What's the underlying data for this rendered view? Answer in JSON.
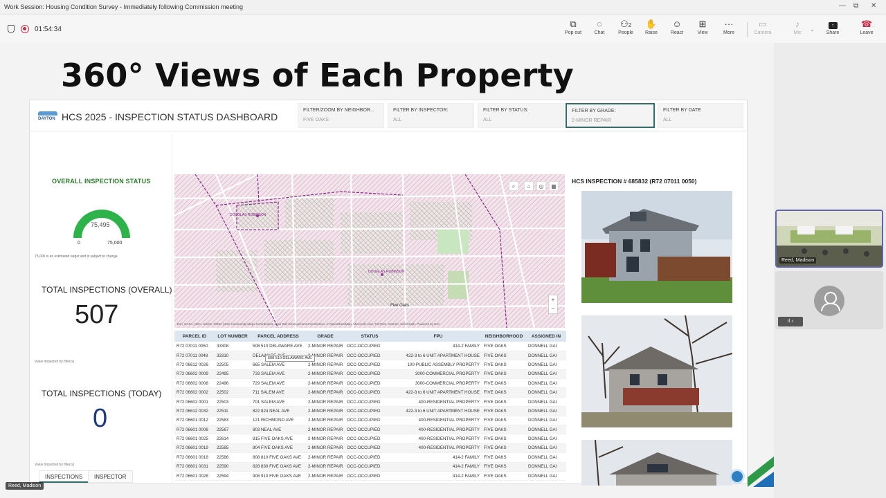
{
  "window": {
    "title": "Work Session: Housing Condition Survey - Immediately following Commission meeting"
  },
  "toolbar": {
    "timer": "01:54:34",
    "buttons": [
      {
        "label": "Pop out",
        "icon": "pop-out-icon"
      },
      {
        "label": "Chat",
        "icon": "chat-icon"
      },
      {
        "label": "People",
        "icon": "people-icon",
        "count": "2"
      },
      {
        "label": "Raise",
        "icon": "raise-hand-icon"
      },
      {
        "label": "React",
        "icon": "react-icon"
      },
      {
        "label": "View",
        "icon": "view-icon"
      },
      {
        "label": "More",
        "icon": "more-icon"
      },
      {
        "label": "Camera",
        "icon": "camera-icon",
        "disabled": true
      },
      {
        "label": "Mic",
        "icon": "mic-icon",
        "disabled": true
      },
      {
        "label": "Share",
        "icon": "share-icon"
      },
      {
        "label": "Leave",
        "icon": "leave-icon"
      }
    ]
  },
  "slide": {
    "title": "360° Views of Each Property"
  },
  "dashboard": {
    "title": "HCS 2025 - INSPECTION STATUS DASHBOARD",
    "logo_text": "DAYTON",
    "filters": [
      {
        "label": "FILTER/ZOOM BY NEIGHBOR...",
        "value": "FIVE OAKS"
      },
      {
        "label": "FILTER BY INSPECTOR:",
        "value": "ALL"
      },
      {
        "label": "FILTER BY STATUS:",
        "value": "ALL"
      },
      {
        "label": "FILTER BY GRADE:",
        "value": "2-MINOR REPAIR",
        "active": true
      },
      {
        "label": "FILTER BY DATE",
        "value": "ALL"
      }
    ],
    "overall": {
      "title": "OVERALL INSPECTION STATUS",
      "gauge_value": "75,495",
      "gauge_min": "0",
      "gauge_max": "75,000",
      "gauge_fraction": 1.0,
      "note": "75,000 is an estimated target and is subject to change"
    },
    "total_overall": {
      "label": "TOTAL INSPECTIONS (OVERALL)",
      "value": "507",
      "note": "Value impacted by filter(s)"
    },
    "total_today": {
      "label": "TOTAL INSPECTIONS (TODAY)",
      "value": "0",
      "note": "Value impacted by filter(s)"
    },
    "tabs": [
      "INSPECTIONS",
      "INSPECTOR"
    ],
    "map": {
      "labels": [
        "DOUGLAS ROBINSON",
        "DOUGLAS ROBINSON",
        "Five Oaks"
      ],
      "attribution": "Esri, NASA, NGA, USGS, FEMA | Esri Community Maps Contributors, Ohio Rail Development Commission, © OpenStreetMap, Microsoft, Esri, TomTom, Garmin, SafeGraph,   Powered by Esri",
      "zoom_in": "+",
      "zoom_out": "−"
    },
    "table": {
      "columns": [
        "PARCEL ID",
        "LOT NUMBER",
        "PARCEL ADDRESS",
        "GRADE",
        "STATUS",
        "FPU",
        "NEIGHBORHOOD",
        "ASSIGNED IN"
      ],
      "rows": [
        [
          "R72 07011 0050",
          "33308",
          "508 510 DELAWARE AVE",
          "2-MINOR REPAIR",
          "OCC-OCCUPIED",
          "414-2 FAMILY",
          "FIVE OAKS",
          "DONNELL GAI"
        ],
        [
          "R72 07011 0048",
          "33310",
          "DELAWARE AVE",
          "2-MINOR REPAIR",
          "OCC-OCCUPIED",
          "422-3 to 6 UNIT APARTMENT HOUSE",
          "FIVE OAKS",
          "DONNELL GAI"
        ],
        [
          "R72 06612 0026",
          "22505",
          "665 SALEM AVE",
          "2-MINOR REPAIR",
          "OCC-OCCUPIED",
          "100-PUBLIC ASSEMBLY PROPERTY",
          "FIVE OAKS",
          "DONNELL GAI"
        ],
        [
          "R72 06602 0009",
          "22495",
          "733 SALEM AVE",
          "2-MINOR REPAIR",
          "OCC-OCCUPIED",
          "3000-COMMERCIAL PROPERTY",
          "FIVE OAKS",
          "DONNELL GAI"
        ],
        [
          "R72 06602 0008",
          "22496",
          "729 SALEM AVE",
          "2-MINOR REPAIR",
          "OCC-OCCUPIED",
          "3000-COMMERCIAL PROPERTY",
          "FIVE OAKS",
          "DONNELL GAI"
        ],
        [
          "R72 06602 0002",
          "22502",
          "711 SALEM AVE",
          "2-MINOR REPAIR",
          "OCC-OCCUPIED",
          "422-3 to 6 UNIT APARTMENT HOUSE",
          "FIVE OAKS",
          "DONNELL GAI"
        ],
        [
          "R72 06602 0001",
          "22503",
          "701 SALEM AVE",
          "2-MINOR REPAIR",
          "OCC-OCCUPIED",
          "400-RESIDENTIAL PROPERTY",
          "FIVE OAKS",
          "DONNELL GAI"
        ],
        [
          "R72 06612 0032",
          "22511",
          "822 824 NEAL AVE",
          "2-MINOR REPAIR",
          "OCC-OCCUPIED",
          "422-3 to 6 UNIT APARTMENT HOUSE",
          "FIVE OAKS",
          "DONNELL GAI"
        ],
        [
          "R72 06601 0012",
          "22583",
          "121 RICHMOND AVE",
          "2-MINOR REPAIR",
          "OCC-OCCUPIED",
          "400-RESIDENTIAL PROPERTY",
          "FIVE OAKS",
          "DONNELL GAI"
        ],
        [
          "R72 06601 0008",
          "22567",
          "803 NEAL AVE",
          "2-MINOR REPAIR",
          "OCC-OCCUPIED",
          "400-RESIDENTIAL PROPERTY",
          "FIVE OAKS",
          "DONNELL GAI"
        ],
        [
          "R72 06601 0025",
          "22614",
          "815 FIVE OAKS AVE",
          "2-MINOR REPAIR",
          "OCC-OCCUPIED",
          "400-RESIDENTIAL PROPERTY",
          "FIVE OAKS",
          "DONNELL GAI"
        ],
        [
          "R72 06601 0019",
          "22585",
          "804 FIVE OAKS AVE",
          "2-MINOR REPAIR",
          "OCC-OCCUPIED",
          "400-RESIDENTIAL PROPERTY",
          "FIVE OAKS",
          "DONNELL GAI"
        ],
        [
          "R72 06601 0018",
          "22586",
          "808 810 FIVE OAKS AVE",
          "2-MINOR REPAIR",
          "OCC-OCCUPIED",
          "414-2 FAMILY",
          "FIVE OAKS",
          "DONNELL GAI"
        ],
        [
          "R72 06601 0031",
          "22590",
          "828 830 FIVE OAKS AVE",
          "2-MINOR REPAIR",
          "OCC-OCCUPIED",
          "414-2 FAMILY",
          "FIVE OAKS",
          "DONNELL GAI"
        ],
        [
          "R72 06601 0028",
          "22594",
          "908 910 FIVE OAKS AVE",
          "2-MINOR REPAIR",
          "OCC-OCCUPIED",
          "414-2 FAMILY",
          "FIVE OAKS",
          "DONNELL GAI"
        ]
      ],
      "tooltip": "508 510 DELAWARE AVE"
    },
    "inspection": {
      "title": "HCS INSPECTION # 685832 (R72 07011 0050)"
    }
  },
  "participants": {
    "tile_name": "Reed, Madison",
    "self_name": "Reed, Madison"
  },
  "colors": {
    "accent": "#6264a7",
    "gauge": "#2db34a",
    "leave": "#c4314b",
    "kpi_blue": "#1f3a7a"
  }
}
